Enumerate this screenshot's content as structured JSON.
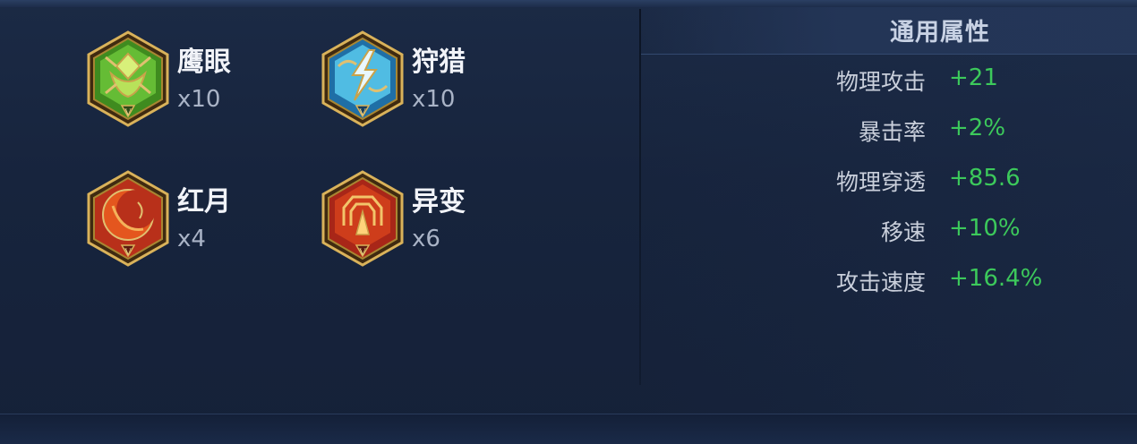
{
  "colors": {
    "background": "#17243d",
    "label": "#c9cfdb",
    "value_green": "#3cc95b",
    "rune_name": "#f1f3f8",
    "rune_count": "#a9b3c6"
  },
  "runes": [
    {
      "name": "鹰眼",
      "count": "x10",
      "icon": "green-eagle-eye-rune-icon",
      "color": "#4e9a2a"
    },
    {
      "name": "狩猎",
      "count": "x10",
      "icon": "blue-lightning-hunt-rune-icon",
      "color": "#3aa9d8"
    },
    {
      "name": "红月",
      "count": "x4",
      "icon": "red-moon-rune-icon",
      "color": "#d2401c"
    },
    {
      "name": "异变",
      "count": "x6",
      "icon": "red-mutation-rune-icon",
      "color": "#c8321c"
    }
  ],
  "attributes": {
    "title": "通用属性",
    "items": [
      {
        "label": "物理攻击",
        "value": "+21"
      },
      {
        "label": "暴击率",
        "value": "+2%"
      },
      {
        "label": "物理穿透",
        "value": "+85.6"
      },
      {
        "label": "移速",
        "value": "+10%"
      },
      {
        "label": "攻击速度",
        "value": "+16.4%"
      }
    ]
  }
}
